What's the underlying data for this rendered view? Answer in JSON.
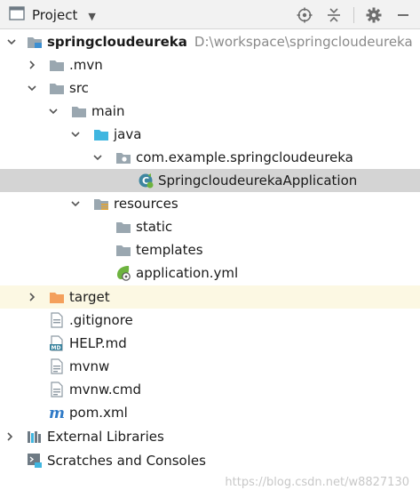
{
  "toolbar": {
    "title": "Project",
    "icons": [
      "project-view-icon",
      "locate-icon",
      "collapse-icon",
      "settings-icon",
      "hide-icon"
    ]
  },
  "tree": {
    "root": {
      "name": "springcloudeureka",
      "path": "D:\\workspace\\springcloudeureka"
    },
    "mvn": ".mvn",
    "src": "src",
    "main": "main",
    "java": "java",
    "package": "com.example.springcloudeureka",
    "app_class": "SpringcloudeurekaApplication",
    "resources": "resources",
    "static": "static",
    "templates": "templates",
    "app_yml": "application.yml",
    "target": "target",
    "gitignore": ".gitignore",
    "help": "HELP.md",
    "mvnw": "mvnw",
    "mvnw_cmd": "mvnw.cmd",
    "pom": "pom.xml",
    "ext_libs": "External Libraries",
    "scratches": "Scratches and Consoles"
  },
  "colors": {
    "selected_row": "#d4d4d4",
    "excluded_row": "#fcf8e3",
    "folder_gray": "#9aa7b0",
    "source_folder": "#40b6e0",
    "excluded_folder": "#f4a05c",
    "spring_green": "#6db33f",
    "maven_blue": "#2f7ac7"
  },
  "watermark": "https://blog.csdn.net/w8827130"
}
